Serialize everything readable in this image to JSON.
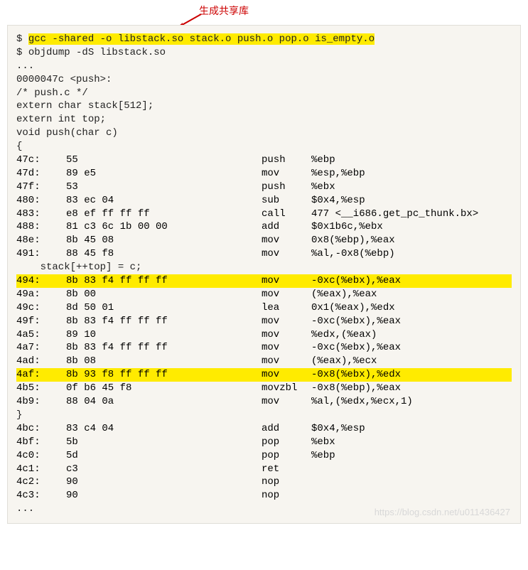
{
  "annotation": "生成共享库",
  "cmd1_prompt": "$ ",
  "cmd1": "gcc -shared -o libstack.so stack.o push.o pop.o is_empty.o",
  "cmd2_prompt": "$ ",
  "cmd2": "objdump -dS libstack.so",
  "ellipsis1": "...",
  "func_header": "0000047c <push>:",
  "src1": "/* push.c */",
  "src2": "extern char stack[512];",
  "src3": "extern int top;",
  "src4": "",
  "src5": "void push(char c)",
  "src6": "{",
  "asm_top": [
    {
      "addr": " 47c:",
      "bytes": "   55",
      "mn": "push",
      "op": "%ebp"
    },
    {
      "addr": " 47d:",
      "bytes": "   89 e5",
      "mn": "mov",
      "op": "%esp,%ebp"
    },
    {
      "addr": " 47f:",
      "bytes": "   53",
      "mn": "push",
      "op": "%ebx"
    },
    {
      "addr": " 480:",
      "bytes": "   83 ec 04",
      "mn": "sub",
      "op": "$0x4,%esp"
    },
    {
      "addr": " 483:",
      "bytes": "   e8 ef ff ff ff",
      "mn": "call",
      "op": "477 <__i686.get_pc_thunk.bx>"
    },
    {
      "addr": " 488:",
      "bytes": "   81 c3 6c 1b 00 00",
      "mn": "add",
      "op": "$0x1b6c,%ebx"
    },
    {
      "addr": " 48e:",
      "bytes": "   8b 45 08",
      "mn": "mov",
      "op": "0x8(%ebp),%eax"
    },
    {
      "addr": " 491:",
      "bytes": "   88 45 f8",
      "mn": "mov",
      "op": "%al,-0x8(%ebp)"
    }
  ],
  "src_mid": "    stack[++top] = c;",
  "asm_hl1": {
    "addr": " 494:",
    "bytes": "   8b 83 f4 ff ff ff",
    "mn": "mov",
    "op": "-0xc(%ebx),%eax"
  },
  "asm_mid": [
    {
      "addr": " 49a:",
      "bytes": "   8b 00",
      "mn": "mov",
      "op": "(%eax),%eax"
    },
    {
      "addr": " 49c:",
      "bytes": "   8d 50 01",
      "mn": "lea",
      "op": "0x1(%eax),%edx"
    },
    {
      "addr": " 49f:",
      "bytes": "   8b 83 f4 ff ff ff",
      "mn": "mov",
      "op": "-0xc(%ebx),%eax"
    },
    {
      "addr": " 4a5:",
      "bytes": "   89 10",
      "mn": "mov",
      "op": "%edx,(%eax)"
    },
    {
      "addr": " 4a7:",
      "bytes": "   8b 83 f4 ff ff ff",
      "mn": "mov",
      "op": "-0xc(%ebx),%eax"
    },
    {
      "addr": " 4ad:",
      "bytes": "   8b 08",
      "mn": "mov",
      "op": "(%eax),%ecx"
    }
  ],
  "asm_hl2": {
    "addr": " 4af:",
    "bytes": "   8b 93 f8 ff ff ff",
    "mn": "mov",
    "op": "-0x8(%ebx),%edx"
  },
  "asm_post": [
    {
      "addr": " 4b5:",
      "bytes": "   0f b6 45 f8",
      "mn": "movzbl",
      "op": "-0x8(%ebp),%eax"
    },
    {
      "addr": " 4b9:",
      "bytes": "   88 04 0a",
      "mn": "mov",
      "op": "%al,(%edx,%ecx,1)"
    }
  ],
  "src_close": "}",
  "asm_tail": [
    {
      "addr": " 4bc:",
      "bytes": "   83 c4 04",
      "mn": "add",
      "op": "$0x4,%esp"
    },
    {
      "addr": " 4bf:",
      "bytes": "   5b",
      "mn": "pop",
      "op": "%ebx"
    },
    {
      "addr": " 4c0:",
      "bytes": "   5d",
      "mn": "pop",
      "op": "%ebp"
    },
    {
      "addr": " 4c1:",
      "bytes": "   c3",
      "mn": "ret",
      "op": ""
    },
    {
      "addr": " 4c2:",
      "bytes": "   90",
      "mn": "nop",
      "op": ""
    },
    {
      "addr": " 4c3:",
      "bytes": "   90",
      "mn": "nop",
      "op": ""
    }
  ],
  "ellipsis2": "...",
  "watermark": "https://blog.csdn.net/u011436427"
}
